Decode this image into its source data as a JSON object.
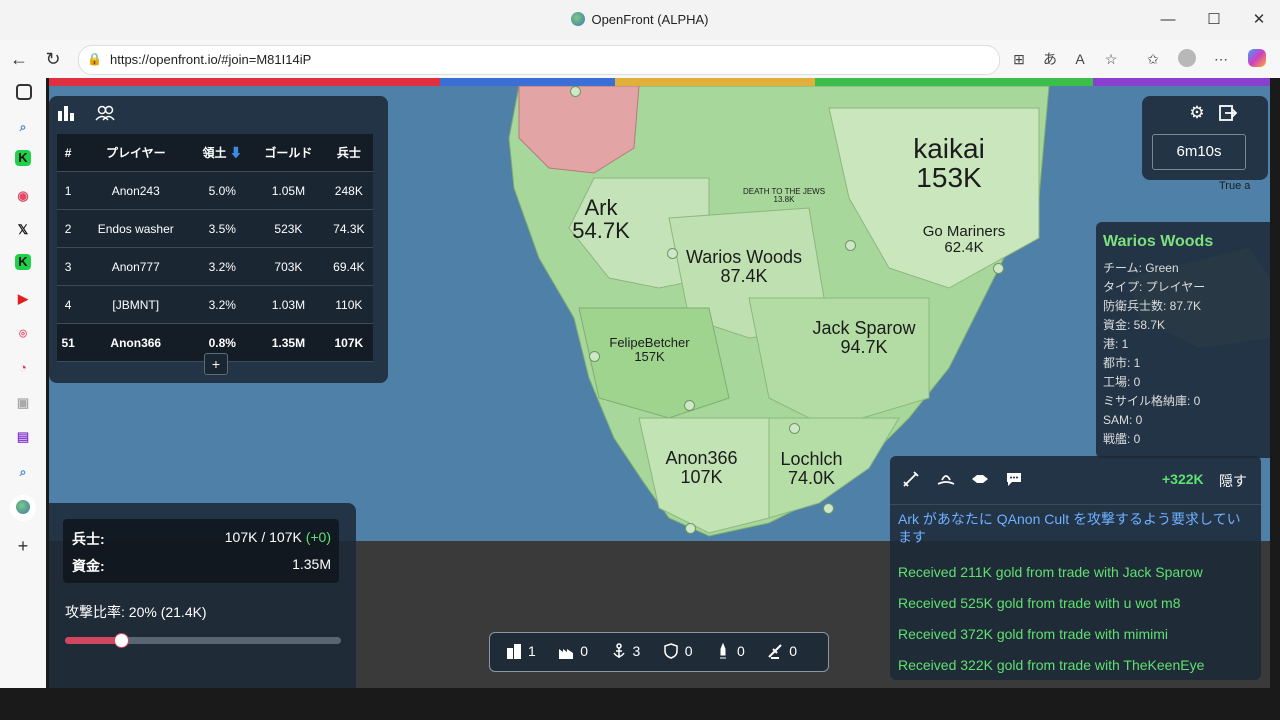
{
  "browser": {
    "title": "OpenFront (ALPHA)",
    "url": "https://openfront.io/#join=M81I14iP",
    "controls": {
      "minimize": "—",
      "maximize": "☐",
      "close": "✕"
    }
  },
  "sidebar_icons": [
    "tabs-icon",
    "search-icon",
    "kick-icon",
    "circle-icon",
    "x-icon",
    "kick-icon-2",
    "youtube-icon",
    "location-icon",
    "gauge-icon",
    "image-icon",
    "twitch-icon",
    "search-icon-2",
    "openfront-icon",
    "add-icon"
  ],
  "player_colors": [
    "#e0303f",
    "#3b6fd6",
    "#e0b03a",
    "#3bbf4a",
    "#8a3fd1"
  ],
  "leaderboard": {
    "headers": [
      "#",
      "プレイヤー",
      "領土",
      "ゴールド",
      "兵士"
    ],
    "sort_indicator": "⬇",
    "rows": [
      {
        "rank": "1",
        "name": "Anon243",
        "territory": "5.0%",
        "gold": "1.05M",
        "troops": "248K"
      },
      {
        "rank": "2",
        "name": "Endos washer",
        "territory": "3.5%",
        "gold": "523K",
        "troops": "74.3K"
      },
      {
        "rank": "3",
        "name": "Anon777",
        "territory": "3.2%",
        "gold": "703K",
        "troops": "69.4K"
      },
      {
        "rank": "4",
        "name": "[JBMNT]",
        "territory": "3.2%",
        "gold": "1.03M",
        "troops": "110K"
      },
      {
        "rank": "51",
        "name": "Anon366",
        "territory": "0.8%",
        "gold": "1.35M",
        "troops": "107K"
      }
    ],
    "expand_label": "+"
  },
  "timer": "6m10s",
  "map_labels": [
    {
      "name": "kaikai",
      "value": "153K"
    },
    {
      "name": "Ark",
      "value": "54.7K"
    },
    {
      "name": "Warios Woods",
      "value": "87.4K"
    },
    {
      "name": "Go Mariners",
      "value": "62.4K"
    },
    {
      "name": "Jack Sparow",
      "value": "94.7K"
    },
    {
      "name": "FelipeBetcher",
      "value": "157K"
    },
    {
      "name": "Anon366",
      "value": "107K"
    },
    {
      "name": "Lochlch",
      "value": "74.0K"
    },
    {
      "name": "DEATH TO THE JEWS",
      "value": "13.8K"
    },
    {
      "name": "True a",
      "value": ""
    }
  ],
  "player_info": {
    "name": "Warios Woods",
    "stats": [
      "チーム: Green",
      "タイプ: プレイヤー",
      "防衛兵士数: 87.7K",
      "資金: 58.7K",
      "港: 1",
      "都市: 1",
      "工場: 0",
      "ミサイル格納庫: 0",
      "SAM: 0",
      "戦艦: 0"
    ]
  },
  "control_panel": {
    "troops_label": "兵士:",
    "troops_value": "107K / 107K",
    "troops_delta": "(+0)",
    "gold_label": "資金:",
    "gold_value": "1.35M",
    "attack_ratio_label": "攻撃比率: 20% (21.4K)",
    "attack_ratio": 0.2
  },
  "buildings_bar": [
    {
      "icon": "city-icon",
      "count": "1"
    },
    {
      "icon": "factory-icon",
      "count": "0"
    },
    {
      "icon": "port-icon",
      "count": "3"
    },
    {
      "icon": "defense-post-icon",
      "count": "0"
    },
    {
      "icon": "missile-silo-icon",
      "count": "0"
    },
    {
      "icon": "sam-launcher-icon",
      "count": "0"
    }
  ],
  "events": {
    "gold_delta": "+322K",
    "hide_label": "隠す",
    "messages": [
      {
        "text": "Ark があなたに QAnon Cult を攻撃するよう要求しています",
        "color": "#6fb0ff"
      },
      {
        "text": "Received 211K gold from trade with Jack Sparow",
        "color": "#5fe070"
      },
      {
        "text": "Received 525K gold from trade with u wot m8",
        "color": "#5fe070"
      },
      {
        "text": "Received 372K gold from trade with mimimi",
        "color": "#5fe070"
      },
      {
        "text": "Received 322K gold from trade with TheKeenEye",
        "color": "#5fe070"
      }
    ]
  }
}
